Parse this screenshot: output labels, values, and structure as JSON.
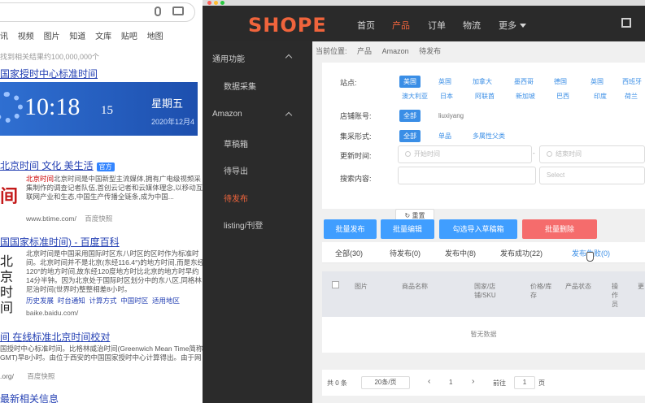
{
  "background_search": {
    "tabs": [
      "讯",
      "视频",
      "图片",
      "知道",
      "文库",
      "贴吧",
      "地图"
    ],
    "result_count": "找到相关结果约100,000,000个",
    "result1_title": "国家授时中心标准时间",
    "clock": {
      "time": "10:18",
      "seconds": "15",
      "weekday": "星期五",
      "date": "2020年12月4"
    },
    "result2_title": "北京时间 文化 美生活",
    "result2_badge": "官方",
    "result2_snippet": "北京时间是中国新型主流媒体,拥有广电级视频采集制作的调查记者队伍,首创云记者和云媒体理念,以移动互联网产业和生态,中国生产传播全链条,成为中国...",
    "result2_snippet_highlight": "北京时间",
    "result2_logo": "间",
    "result2_url": "www.btime.com/",
    "result2_snapshot": "百度快照",
    "result3_title": "国国家标准时间) - 百度百科",
    "result3_logo": "北京时间",
    "result3_snippet": "北京时间是中国采用国际时区东八时区的区时作为标准时间。北京时间并不是北京(东经116.4°)的地方时间,而是东经120°的地方时间,故东经120度地方时比北京的地方时早约14分半钟。因为北京处于国际时区划分中的东八区,同格林尼治时间(世界时)整整相差8小时。",
    "result3_links": [
      "历史发展",
      "时台通知",
      "计算方式",
      "中国时区",
      "适用地区"
    ],
    "result3_url": "baike.baidu.com/",
    "result4_title": "间 在线标准北京时间校对",
    "result4_snippet": "国授时中心标准时间。比格林威治时间(Greenwich Mean Time简称GMT)早8小时。由位于西安的中国国家授时中心计算得出。由于网络传输原因,现在北...",
    "result4_url": ".org/",
    "result4_snapshot": "百度快照",
    "result5_title": "最新相关信息"
  },
  "app": {
    "brand": "SHOPE",
    "nav": [
      "首页",
      "产品",
      "订单",
      "物流",
      "更多"
    ],
    "nav_active": "产品",
    "sidebar": {
      "group1": "通用功能",
      "item_collect": "数据采集",
      "group2": "Amazon",
      "items": [
        "草稿箱",
        "待导出",
        "待发布",
        "listing/刊登"
      ],
      "active": "待发布"
    },
    "breadcrumb": [
      "当前位置:",
      "产品",
      "Amazon",
      "待发布"
    ],
    "filters": {
      "site_label": "站点:",
      "sites_row1": [
        "美国",
        "英国",
        "加拿大",
        "墨西哥",
        "德国",
        "英国",
        "西班牙"
      ],
      "sites_row2": [
        "澳大利亚",
        "日本",
        "阿联酋",
        "新加坡",
        "巴西",
        "印度",
        "荷兰"
      ],
      "shop_label": "店铺账号:",
      "shop_all": "全部",
      "shop_account": "liuxiyang",
      "collect_label": "集采形式:",
      "collect_options": [
        "全部",
        "单品",
        "多属性父类"
      ],
      "time_label": "更新时间:",
      "start_placeholder": "开始时间",
      "end_placeholder": "结束时间",
      "search_label": "搜索内容:",
      "select_placeholder": "Select",
      "reset": "重置"
    },
    "actions": [
      {
        "label": "批量发布",
        "color": "#409eff"
      },
      {
        "label": "批量编辑",
        "color": "#409eff"
      },
      {
        "label": "勾选导入草稿箱",
        "color": "#409eff"
      },
      {
        "label": "批量删除",
        "color": "#f56c6c"
      }
    ],
    "tabs": [
      "全部(30)",
      "待发布(0)",
      "发布中(8)",
      "发布成功(22)",
      "发布失败(0)"
    ],
    "tab_active": "发布失败(0)",
    "table_headers": [
      "图片",
      "商品名称",
      "国家/店铺/SKU",
      "价格/库存",
      "产品状态",
      "操作员",
      "更"
    ],
    "empty_text": "暂无数据",
    "pager": {
      "total": "共 0 条",
      "size": "20条/页",
      "page": "1",
      "goto": "前往",
      "goto_page": "1",
      "unit": "页"
    }
  }
}
